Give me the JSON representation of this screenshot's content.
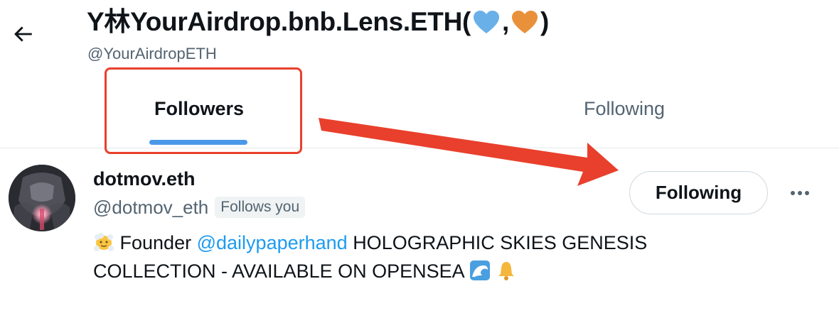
{
  "header": {
    "back_icon": "arrow-left-icon",
    "title_prefix": "Y林YourAirdrop.bnb.Lens.ETH(",
    "title_comma": ",",
    "title_suffix": ")",
    "title_emoji_1": "blue-heart-icon",
    "title_emoji_2": "orange-heart-icon",
    "handle": "@YourAirdropETH"
  },
  "tabs": [
    {
      "label": "Followers",
      "active": true
    },
    {
      "label": "Following",
      "active": false
    }
  ],
  "user": {
    "name": "dotmov.eth",
    "handle": "@dotmov_eth",
    "follows_you_badge": "Follows you",
    "follow_button_label": "Following",
    "more_icon": "more-horizontal-icon",
    "avatar_icon": "avatar-image",
    "bio": {
      "part1": "Founder",
      "mention": "@dailypaperhand",
      "part2": "HOLOGRAPHIC SKIES GENESIS COLLECTION - AVAILABLE ON OPENSEA",
      "emoji_start": "face-in-clouds-icon",
      "emoji_wave": "wave-icon",
      "emoji_bell": "bell-icon"
    }
  },
  "annotations": {
    "highlight_color": "#e8402c",
    "arrow_color": "#e8402c"
  },
  "colors": {
    "accent": "#1d9bf0",
    "tab_indicator": "#4a99e9",
    "secondary_text": "#536471"
  }
}
